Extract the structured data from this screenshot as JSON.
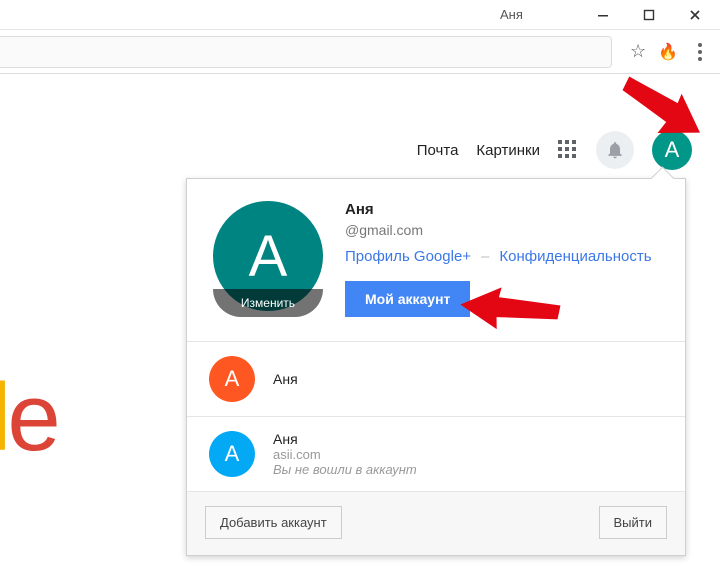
{
  "window": {
    "title": "Аня"
  },
  "header": {
    "mail_label": "Почта",
    "images_label": "Картинки",
    "avatar_letter": "A"
  },
  "account_panel": {
    "main": {
      "avatar_letter": "А",
      "change_label": "Изменить",
      "name": "Аня",
      "email": "@gmail.com",
      "profile_link": "Профиль Google+",
      "privacy_link": "Конфиденциальность",
      "my_account_button": "Мой аккаунт"
    },
    "accounts": [
      {
        "letter": "A",
        "color": "orange",
        "name": "Аня",
        "email": ""
      },
      {
        "letter": "A",
        "color": "blue",
        "name": "Аня",
        "email": "asii.com",
        "note": "Вы не вошли в аккаунт"
      }
    ],
    "footer": {
      "add_account": "Добавить аккаунт",
      "sign_out": "Выйти"
    }
  },
  "logo_fragment": {
    "yellowchar": "l",
    "redchar": "e"
  }
}
